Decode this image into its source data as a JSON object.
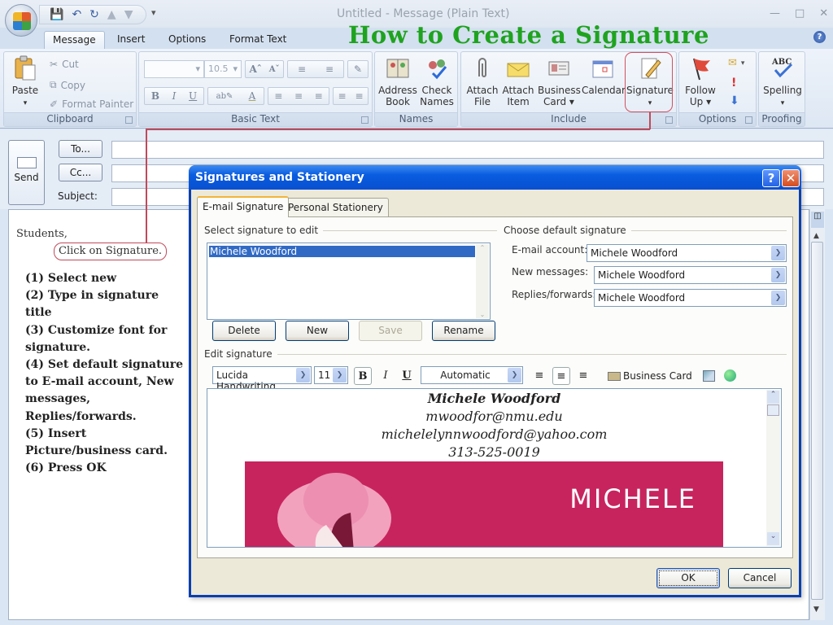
{
  "window": {
    "title": "Untitled - Message (Plain Text)",
    "controls": [
      "minimize",
      "maximize",
      "close"
    ]
  },
  "headline": "How to Create a Signature",
  "quick_access": [
    "save-icon",
    "undo-icon",
    "redo-icon",
    "previous-icon",
    "next-icon"
  ],
  "tabs": [
    {
      "label": "Message",
      "active": true
    },
    {
      "label": "Insert",
      "active": false
    },
    {
      "label": "Options",
      "active": false
    },
    {
      "label": "Format Text",
      "active": false
    }
  ],
  "ribbon": {
    "clipboard": {
      "label": "Clipboard",
      "paste": "Paste",
      "cut": "Cut",
      "copy": "Copy",
      "format_painter": "Format Painter"
    },
    "basic_text": {
      "label": "Basic Text",
      "font_size": "10.5",
      "bold": "B",
      "italic": "I",
      "underline": "U"
    },
    "names": {
      "label": "Names",
      "address_book": [
        "Address",
        "Book"
      ],
      "check_names": [
        "Check",
        "Names"
      ]
    },
    "include": {
      "label": "Include",
      "attach_file": [
        "Attach",
        "File"
      ],
      "attach_item": [
        "Attach",
        "Item"
      ],
      "business_card": [
        "Business",
        "Card ▾"
      ],
      "calendar": [
        "Calendar",
        ""
      ],
      "signature": [
        "Signature",
        "▾"
      ]
    },
    "options": {
      "label": "Options",
      "follow_up": [
        "Follow",
        "Up ▾"
      ]
    },
    "proofing": {
      "label": "Proofing",
      "spelling": [
        "Spelling",
        "▾"
      ]
    }
  },
  "compose": {
    "send": "Send",
    "to": "To...",
    "cc": "Cc...",
    "subject_label": "Subject:",
    "to_value": "",
    "cc_value": "",
    "subject_value": ""
  },
  "body": {
    "greeting": "Students,",
    "callout": "Click on Signature.",
    "steps": [
      "(1) Select new",
      "(2) Type in signature title",
      "(3) Customize font for signature.",
      "(4) Set default signature to E-mail account, New messages, Replies/forwards.",
      "(5) Insert Picture/business card.",
      "(6) Press OK"
    ]
  },
  "dialog": {
    "title": "Signatures and Stationery",
    "help": "?",
    "close": "✕",
    "tabs": [
      {
        "label": "E-mail Signature",
        "active": true
      },
      {
        "label": "Personal Stationery",
        "active": false
      }
    ],
    "select_label": "Select signature to edit",
    "signatures": [
      "Michele Woodford"
    ],
    "selected_signature": "Michele Woodford",
    "buttons": {
      "delete": "Delete",
      "new": "New",
      "save": "Save",
      "rename": "Rename"
    },
    "defaults": {
      "label": "Choose default signature",
      "email_account_label": "E-mail account:",
      "email_account": "Michele Woodford",
      "new_messages_label": "New messages:",
      "new_messages": "Michele Woodford",
      "replies_label": "Replies/forwards:",
      "replies": "Michele Woodford"
    },
    "edit_label": "Edit signature",
    "editor_toolbar": {
      "font": "Lucida Handwriting",
      "size": "11",
      "bold": "B",
      "italic": "I",
      "underline": "U",
      "color": "Automatic",
      "business_card": "Business Card"
    },
    "signature_content": {
      "name": "Michele Woodford",
      "email1": "mwoodfor@nmu.edu",
      "email2": "michelelynnwoodford@yahoo.com",
      "phone": "313-525-0019",
      "card_text": "MICHELE"
    },
    "ok": "OK",
    "cancel": "Cancel"
  },
  "colors": {
    "headline": "#1fa31f",
    "annotation": "#c04a5a",
    "dialog_frame": "#0a3fb0",
    "card": "#c7245e",
    "selection": "#316ac5"
  }
}
